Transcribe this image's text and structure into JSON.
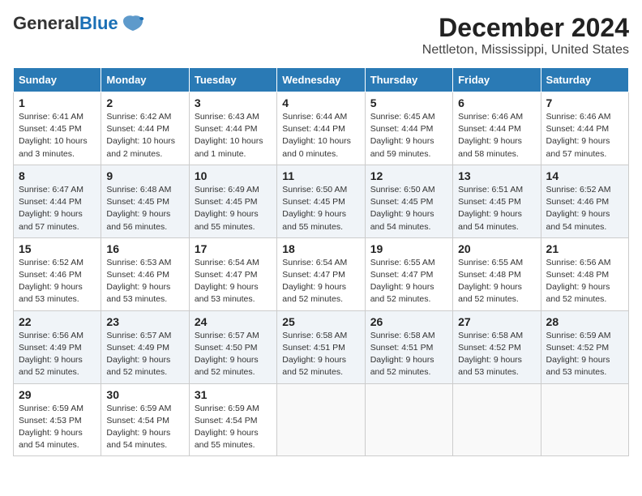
{
  "logo": {
    "text_general": "General",
    "text_blue": "Blue"
  },
  "title": "December 2024",
  "subtitle": "Nettleton, Mississippi, United States",
  "weekdays": [
    "Sunday",
    "Monday",
    "Tuesday",
    "Wednesday",
    "Thursday",
    "Friday",
    "Saturday"
  ],
  "weeks": [
    [
      {
        "day": "1",
        "info": "Sunrise: 6:41 AM\nSunset: 4:45 PM\nDaylight: 10 hours\nand 3 minutes."
      },
      {
        "day": "2",
        "info": "Sunrise: 6:42 AM\nSunset: 4:44 PM\nDaylight: 10 hours\nand 2 minutes."
      },
      {
        "day": "3",
        "info": "Sunrise: 6:43 AM\nSunset: 4:44 PM\nDaylight: 10 hours\nand 1 minute."
      },
      {
        "day": "4",
        "info": "Sunrise: 6:44 AM\nSunset: 4:44 PM\nDaylight: 10 hours\nand 0 minutes."
      },
      {
        "day": "5",
        "info": "Sunrise: 6:45 AM\nSunset: 4:44 PM\nDaylight: 9 hours\nand 59 minutes."
      },
      {
        "day": "6",
        "info": "Sunrise: 6:46 AM\nSunset: 4:44 PM\nDaylight: 9 hours\nand 58 minutes."
      },
      {
        "day": "7",
        "info": "Sunrise: 6:46 AM\nSunset: 4:44 PM\nDaylight: 9 hours\nand 57 minutes."
      }
    ],
    [
      {
        "day": "8",
        "info": "Sunrise: 6:47 AM\nSunset: 4:44 PM\nDaylight: 9 hours\nand 57 minutes."
      },
      {
        "day": "9",
        "info": "Sunrise: 6:48 AM\nSunset: 4:45 PM\nDaylight: 9 hours\nand 56 minutes."
      },
      {
        "day": "10",
        "info": "Sunrise: 6:49 AM\nSunset: 4:45 PM\nDaylight: 9 hours\nand 55 minutes."
      },
      {
        "day": "11",
        "info": "Sunrise: 6:50 AM\nSunset: 4:45 PM\nDaylight: 9 hours\nand 55 minutes."
      },
      {
        "day": "12",
        "info": "Sunrise: 6:50 AM\nSunset: 4:45 PM\nDaylight: 9 hours\nand 54 minutes."
      },
      {
        "day": "13",
        "info": "Sunrise: 6:51 AM\nSunset: 4:45 PM\nDaylight: 9 hours\nand 54 minutes."
      },
      {
        "day": "14",
        "info": "Sunrise: 6:52 AM\nSunset: 4:46 PM\nDaylight: 9 hours\nand 54 minutes."
      }
    ],
    [
      {
        "day": "15",
        "info": "Sunrise: 6:52 AM\nSunset: 4:46 PM\nDaylight: 9 hours\nand 53 minutes."
      },
      {
        "day": "16",
        "info": "Sunrise: 6:53 AM\nSunset: 4:46 PM\nDaylight: 9 hours\nand 53 minutes."
      },
      {
        "day": "17",
        "info": "Sunrise: 6:54 AM\nSunset: 4:47 PM\nDaylight: 9 hours\nand 53 minutes."
      },
      {
        "day": "18",
        "info": "Sunrise: 6:54 AM\nSunset: 4:47 PM\nDaylight: 9 hours\nand 52 minutes."
      },
      {
        "day": "19",
        "info": "Sunrise: 6:55 AM\nSunset: 4:47 PM\nDaylight: 9 hours\nand 52 minutes."
      },
      {
        "day": "20",
        "info": "Sunrise: 6:55 AM\nSunset: 4:48 PM\nDaylight: 9 hours\nand 52 minutes."
      },
      {
        "day": "21",
        "info": "Sunrise: 6:56 AM\nSunset: 4:48 PM\nDaylight: 9 hours\nand 52 minutes."
      }
    ],
    [
      {
        "day": "22",
        "info": "Sunrise: 6:56 AM\nSunset: 4:49 PM\nDaylight: 9 hours\nand 52 minutes."
      },
      {
        "day": "23",
        "info": "Sunrise: 6:57 AM\nSunset: 4:49 PM\nDaylight: 9 hours\nand 52 minutes."
      },
      {
        "day": "24",
        "info": "Sunrise: 6:57 AM\nSunset: 4:50 PM\nDaylight: 9 hours\nand 52 minutes."
      },
      {
        "day": "25",
        "info": "Sunrise: 6:58 AM\nSunset: 4:51 PM\nDaylight: 9 hours\nand 52 minutes."
      },
      {
        "day": "26",
        "info": "Sunrise: 6:58 AM\nSunset: 4:51 PM\nDaylight: 9 hours\nand 52 minutes."
      },
      {
        "day": "27",
        "info": "Sunrise: 6:58 AM\nSunset: 4:52 PM\nDaylight: 9 hours\nand 53 minutes."
      },
      {
        "day": "28",
        "info": "Sunrise: 6:59 AM\nSunset: 4:52 PM\nDaylight: 9 hours\nand 53 minutes."
      }
    ],
    [
      {
        "day": "29",
        "info": "Sunrise: 6:59 AM\nSunset: 4:53 PM\nDaylight: 9 hours\nand 54 minutes."
      },
      {
        "day": "30",
        "info": "Sunrise: 6:59 AM\nSunset: 4:54 PM\nDaylight: 9 hours\nand 54 minutes."
      },
      {
        "day": "31",
        "info": "Sunrise: 6:59 AM\nSunset: 4:54 PM\nDaylight: 9 hours\nand 55 minutes."
      },
      {
        "day": "",
        "info": ""
      },
      {
        "day": "",
        "info": ""
      },
      {
        "day": "",
        "info": ""
      },
      {
        "day": "",
        "info": ""
      }
    ]
  ]
}
